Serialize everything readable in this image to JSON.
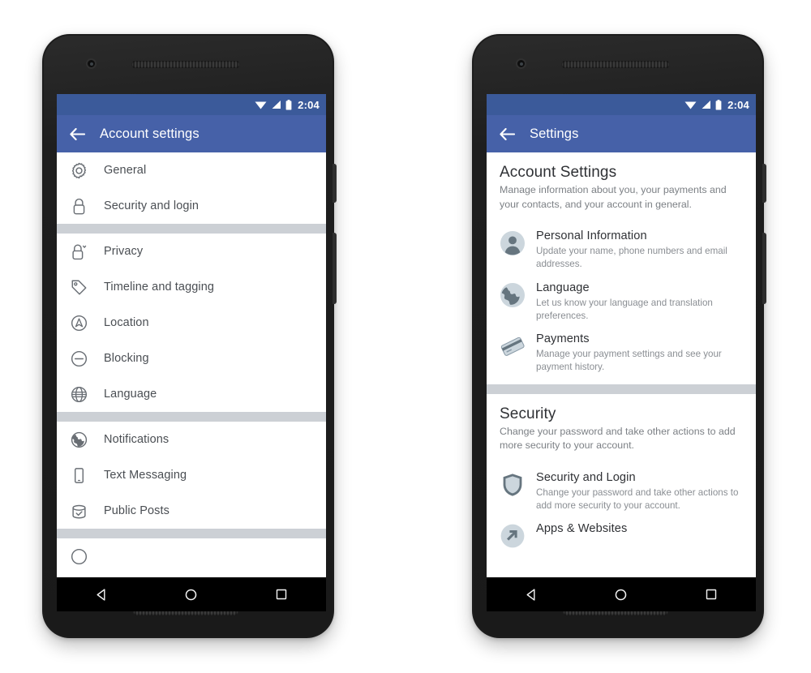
{
  "status_bar": {
    "time": "2:04",
    "icons": [
      "wifi-icon",
      "signal-icon",
      "battery-icon"
    ]
  },
  "colors": {
    "status_bar": "#3b5a9a",
    "toolbar": "#4661a8",
    "divider": "#ccd0d5",
    "label": "#4a4e53",
    "title": "#2f3135",
    "description": "#8a8e93"
  },
  "left_phone": {
    "toolbar": {
      "back_icon": "back-arrow-icon",
      "title": "Account settings"
    },
    "groups": [
      {
        "items": [
          {
            "icon": "gear-icon",
            "label": "General"
          },
          {
            "icon": "lock-icon",
            "label": "Security and login"
          }
        ]
      },
      {
        "items": [
          {
            "icon": "lock-chevron-icon",
            "label": "Privacy"
          },
          {
            "icon": "tag-icon",
            "label": "Timeline and tagging"
          },
          {
            "icon": "location-icon",
            "label": "Location"
          },
          {
            "icon": "block-icon",
            "label": "Blocking"
          },
          {
            "icon": "globe-outline-icon",
            "label": "Language"
          }
        ]
      },
      {
        "items": [
          {
            "icon": "globe-filled-icon",
            "label": "Notifications"
          },
          {
            "icon": "mobile-icon",
            "label": "Text Messaging"
          },
          {
            "icon": "jar-check-icon",
            "label": "Public Posts"
          }
        ]
      }
    ]
  },
  "right_phone": {
    "toolbar": {
      "back_icon": "back-arrow-icon",
      "title": "Settings"
    },
    "sections": [
      {
        "title": "Account Settings",
        "subtitle": "Manage information about you, your payments and your contacts, and your account in general.",
        "items": [
          {
            "icon": "person-avatar-icon",
            "title": "Personal Information",
            "description": "Update your name, phone numbers and email addresses."
          },
          {
            "icon": "globe-icon",
            "title": "Language",
            "description": "Let us know your language and translation preferences."
          },
          {
            "icon": "credit-card-icon",
            "title": "Payments",
            "description": "Manage your payment settings and see your payment history."
          }
        ]
      },
      {
        "title": "Security",
        "subtitle": "Change your password and take other actions to add more security to your account.",
        "items": [
          {
            "icon": "shield-icon",
            "title": "Security and Login",
            "description": "Change your password and take other actions to add more security to your account."
          },
          {
            "icon": "apps-websites-icon",
            "title": "Apps & Websites",
            "description": ""
          }
        ]
      }
    ]
  },
  "nav_bar": {
    "back": "nav-back-icon",
    "home": "nav-home-icon",
    "recents": "nav-recents-icon"
  }
}
